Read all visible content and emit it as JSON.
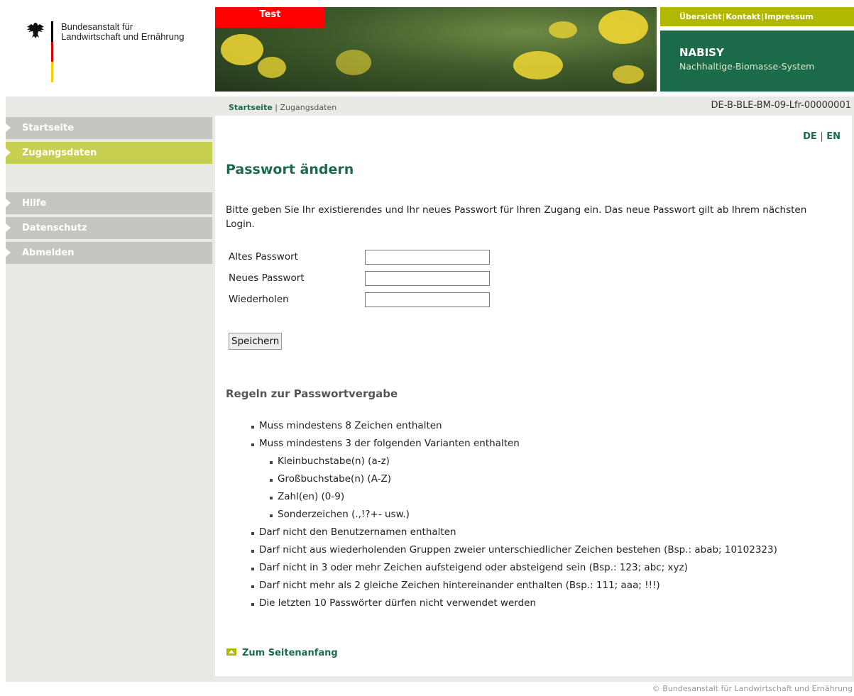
{
  "header": {
    "agency_line1": "Bundesanstalt für",
    "agency_line2": "Landwirtschaft und Ernährung",
    "test_label": "Test",
    "topnav": [
      "Übersicht",
      "Kontakt",
      "Impressum"
    ],
    "app_name": "NABISY",
    "app_subtitle": "Nachhaltige-Biomasse-System"
  },
  "breadcrumb": {
    "home": "Startseite",
    "separator": "|",
    "current": "Zugangsdaten"
  },
  "record_id": "DE-B-BLE-BM-09-Lfr-00000001",
  "sidebar": {
    "items": [
      {
        "label": "Startseite",
        "active": false
      },
      {
        "label": "Zugangsdaten",
        "active": true
      },
      {
        "label": "Hilfe",
        "active": false
      },
      {
        "label": "Datenschutz",
        "active": false
      },
      {
        "label": "Abmelden",
        "active": false
      }
    ]
  },
  "lang": {
    "de": "DE",
    "separator": "|",
    "en": "EN"
  },
  "page": {
    "title": "Passwort ändern",
    "intro": "Bitte geben Sie Ihr existierendes und Ihr neues Passwort für Ihren Zugang ein. Das neue Passwort gilt ab Ihrem nächsten Login."
  },
  "form": {
    "old_password_label": "Altes Passwort",
    "old_password_value": "",
    "new_password_label": "Neues Passwort",
    "new_password_value": "",
    "repeat_label": "Wiederholen",
    "repeat_value": "",
    "save_label": "Speichern"
  },
  "rules": {
    "title": "Regeln zur Passwortvergabe",
    "items": [
      "Muss mindestens 8 Zeichen enthalten",
      "Muss mindestens 3 der folgenden Varianten enthalten",
      "Kleinbuchstabe(n) (a-z)",
      "Großbuchstabe(n) (A-Z)",
      "Zahl(en) (0-9)",
      "Sonderzeichen (.,!?+- usw.)",
      "Darf nicht den Benutzernamen enthalten",
      "Darf nicht aus wiederholenden Gruppen zweier unterschiedlicher Zeichen bestehen (Bsp.: abab; 10102323)",
      "Darf nicht in 3 oder mehr Zeichen aufsteigend oder absteigend sein (Bsp.: 123; abc; xyz)",
      "Darf nicht mehr als 2 gleiche Zeichen hintereinander enthalten (Bsp.: 111; aaa; !!!)",
      "Die letzten 10 Passwörter dürfen nicht verwendet werden"
    ]
  },
  "to_top": "Zum Seitenanfang",
  "footer": "© Bundesanstalt für Landwirtschaft und Ernährung",
  "colors": {
    "brand_green": "#1b6b4b",
    "accent_lime": "#b2b800",
    "active_nav": "#c6cf50",
    "test_red": "#ff0000"
  }
}
